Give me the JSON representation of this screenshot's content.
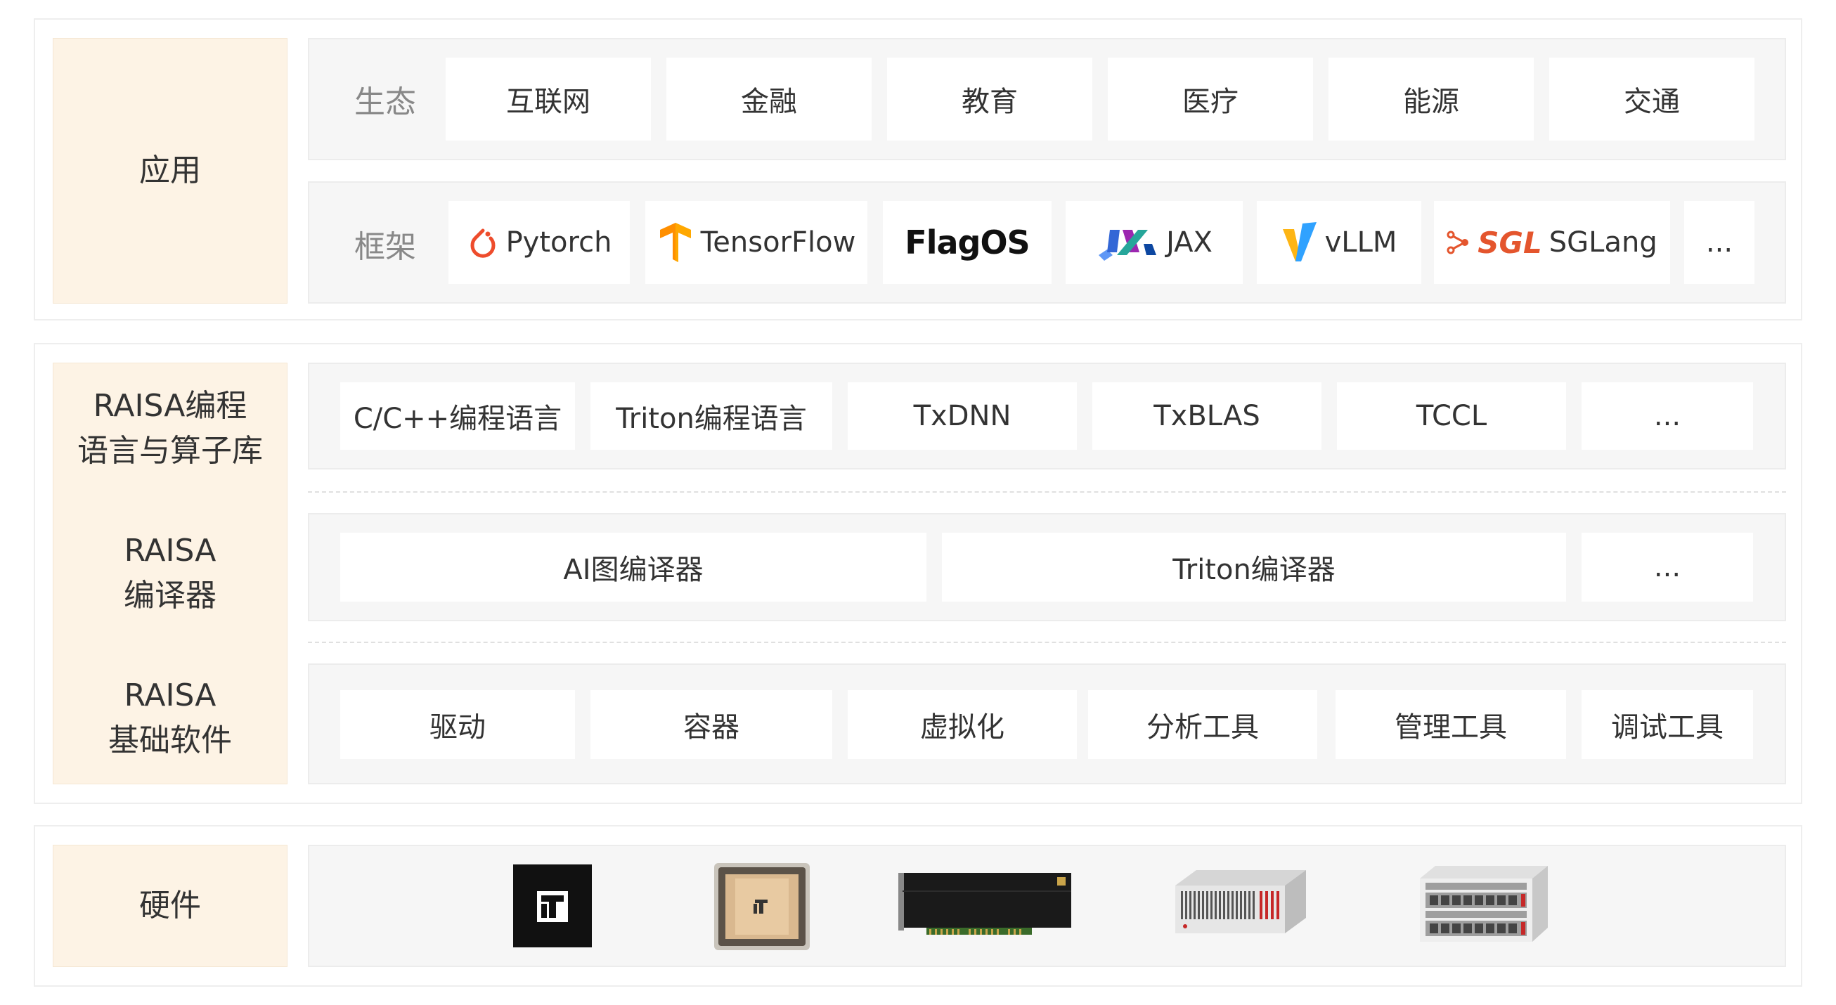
{
  "application": {
    "label": "应用",
    "ecosystem": {
      "tag": "生态",
      "items": [
        "互联网",
        "金融",
        "教育",
        "医疗",
        "能源",
        "交通"
      ]
    },
    "frameworks": {
      "tag": "框架",
      "items": [
        "Pytorch",
        "TensorFlow",
        "FlagOS",
        "JAX",
        "vLLM",
        "SGLang",
        "..."
      ]
    }
  },
  "raisa": {
    "lang_label": [
      "RAISA编程",
      "语言与算子库"
    ],
    "lang_items": [
      "C/C++编程语言",
      "Triton编程语言",
      "TxDNN",
      "TxBLAS",
      "TCCL",
      "..."
    ],
    "compiler_label": [
      "RAISA",
      "编译器"
    ],
    "compiler_items": [
      "AI图编译器",
      "Triton编译器",
      "..."
    ],
    "base_label": [
      "RAISA",
      "基础软件"
    ],
    "base_items": [
      "驱动",
      "容器",
      "虚拟化",
      "分析工具",
      "管理工具",
      "调试工具"
    ]
  },
  "hardware": {
    "label": "硬件",
    "items": [
      "chip-icon",
      "chip-package-icon",
      "accelerator-card-icon",
      "server-icon",
      "rack-server-icon"
    ]
  },
  "logo_text": {
    "sgl_mark": "SGL"
  }
}
